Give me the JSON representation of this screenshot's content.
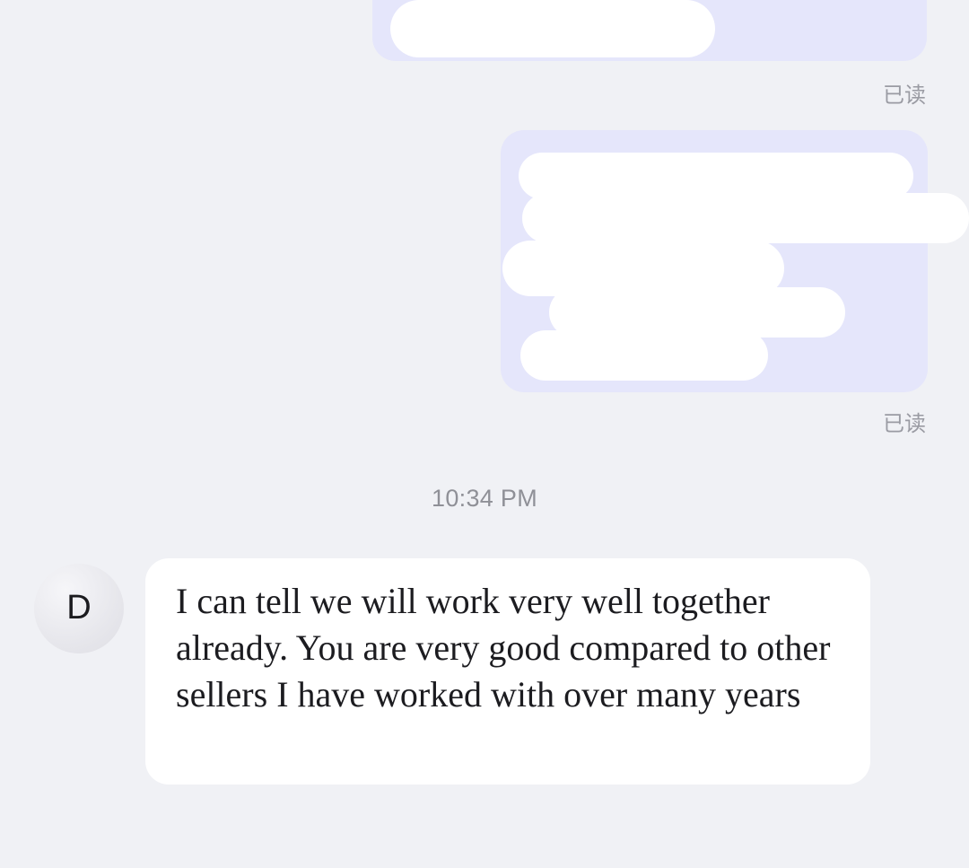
{
  "messages": {
    "outgoing": [
      {
        "redacted": true,
        "read_status": "已读"
      },
      {
        "redacted": true,
        "read_status": "已读"
      }
    ],
    "timestamp": "10:34 PM",
    "incoming": {
      "avatar_letter": "D",
      "text": "I can tell we will work very well together already. You are very good compared to other sellers I have worked with over many years"
    }
  },
  "colors": {
    "background": "#f0f1f5",
    "outgoing_bubble": "#e5e6fb",
    "incoming_bubble": "#ffffff",
    "meta_text": "#9a9ba3"
  }
}
